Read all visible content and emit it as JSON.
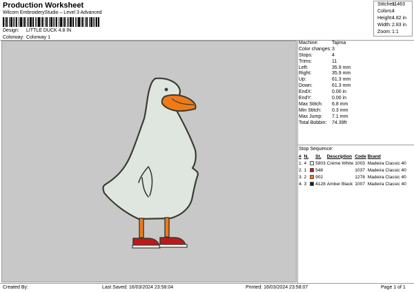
{
  "header": {
    "title": "Production Worksheet",
    "software": "Wilcom EmbroideryStudio – Level 3 Advanced"
  },
  "meta": {
    "design_label": "Design:",
    "design_value": "LITTLE DUCK 4.8 IN",
    "colorway_label": "Colorway:",
    "colorway_value": "Colorway 1"
  },
  "top_stats": [
    {
      "label": "Stitches:",
      "value": "11463"
    },
    {
      "label": "Colors:",
      "value": "4"
    },
    {
      "label": "Height:",
      "value": "4.82 in"
    },
    {
      "label": "Width:",
      "value": "2.83 in"
    },
    {
      "label": "Zoom:",
      "value": "1:1"
    }
  ],
  "machine_info": [
    {
      "label": "Machine:",
      "value": "Tajima"
    },
    {
      "label": "Color changes:",
      "value": "3"
    },
    {
      "label": "Stops:",
      "value": "4"
    },
    {
      "label": "Trims:",
      "value": "11"
    },
    {
      "label": "Left:",
      "value": "35.9 mm"
    },
    {
      "label": "Right:",
      "value": "35.9 mm"
    },
    {
      "label": "Up:",
      "value": "61.3 mm"
    },
    {
      "label": "Down:",
      "value": "61.3 mm"
    },
    {
      "label": "EndX:",
      "value": "0.00 in"
    },
    {
      "label": "EndY:",
      "value": "0.00 in"
    },
    {
      "label": "Max Stitch:",
      "value": "6.8 mm"
    },
    {
      "label": "Min Stitch:",
      "value": "0.3 mm"
    },
    {
      "label": "Max Jump:",
      "value": "7.1 mm"
    },
    {
      "label": "Total Bobbin:",
      "value": "74.39ft"
    }
  ],
  "stop_sequence": {
    "caption": "Stop Sequence:",
    "headers": [
      "#",
      "N.",
      "",
      "St.",
      "Description",
      "Code",
      "Brand"
    ],
    "rows": [
      {
        "num": "1.",
        "n": "4",
        "color": "#eeeeee",
        "st": "5903",
        "desc": "Crème White",
        "code": "1003",
        "brand": "Madeira Classic 40"
      },
      {
        "num": "2.",
        "n": "1",
        "color": "#c01818",
        "st": "548",
        "desc": "",
        "code": "1037",
        "brand": "Madeira Classic 40"
      },
      {
        "num": "3.",
        "n": "2",
        "color": "#f07a18",
        "st": "902",
        "desc": "",
        "code": "1278",
        "brand": "Madeira Classic 40"
      },
      {
        "num": "4.",
        "n": "3",
        "color": "#1e1e1e",
        "st": "4128",
        "desc": "Amber Black",
        "code": "1007",
        "brand": "Madeira Classic 40"
      }
    ]
  },
  "colors": {
    "canvas_bg": "#c8c8c8",
    "duck_body": "#dfe6df",
    "duck_outline": "#3a3a30",
    "beak": "#f07a18",
    "legs": "#f07a18",
    "shoes": "#c01818"
  },
  "footer": {
    "created_by": "Created By:",
    "last_saved": "Last Saved: 16/03/2024 23:58:04",
    "printed": "Printed: 16/03/2024 23:58:07",
    "page": "Page 1 of 1"
  }
}
